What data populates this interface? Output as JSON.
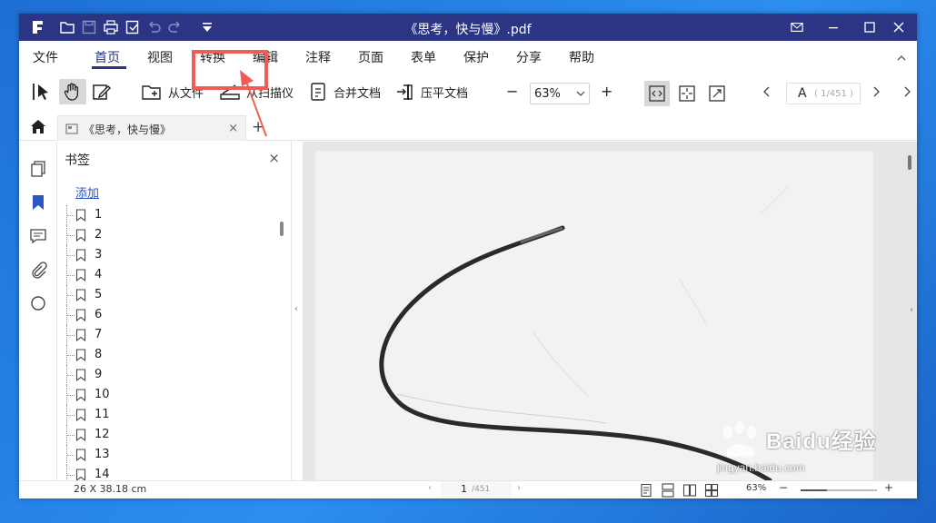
{
  "window": {
    "title": "《思考，快与慢》.pdf"
  },
  "menu": {
    "items": [
      "文件",
      "首页",
      "视图",
      "转换",
      "编辑",
      "注释",
      "页面",
      "表单",
      "保护",
      "分享",
      "帮助"
    ],
    "active": "首页"
  },
  "toolbar": {
    "from_file": "从文件",
    "from_scanner": "从扫描仪",
    "merge_docs": "合并文档",
    "flatten_docs": "压平文档",
    "zoom_minus": "−",
    "zoom_value": "63%",
    "zoom_plus": "+",
    "page_prefix": "A",
    "page_indicator": "( 1/451 )"
  },
  "tabs": {
    "doc_tab": "《思考，快与慢》",
    "close": "×",
    "new_tab": "+"
  },
  "bookmarks": {
    "title": "书签",
    "close": "×",
    "add": "添加",
    "items": [
      "1",
      "2",
      "3",
      "4",
      "5",
      "6",
      "7",
      "8",
      "9",
      "10",
      "11",
      "12",
      "13",
      "14"
    ]
  },
  "status": {
    "dimensions": "26 X 38.18 cm",
    "page_current": "1",
    "page_total": "/451",
    "zoom": "63%",
    "zoom_minus": "−",
    "zoom_plus": "+",
    "zoom_level": 0.35
  },
  "colors": {
    "titlebar": "#2b3584",
    "accent": "#2b3584",
    "annotation": "#f25c54"
  },
  "watermark": {
    "text": "Baidu经验",
    "sub": "jingyan.baidu.com"
  }
}
